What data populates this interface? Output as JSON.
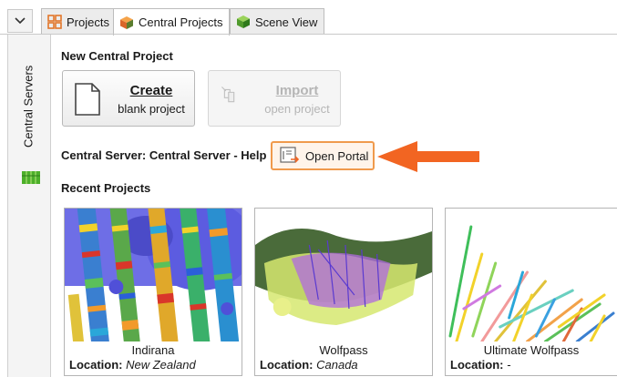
{
  "tabs": [
    {
      "label": "Projects",
      "icon": "projects-grid-icon"
    },
    {
      "label": "Central Projects",
      "icon": "central-cube-icon"
    },
    {
      "label": "Scene View",
      "icon": "scene-cube-icon"
    }
  ],
  "side_panel": {
    "label": "Central Servers",
    "icon": "server-rack-icon"
  },
  "new_project": {
    "title": "New Central Project",
    "create": {
      "label": "Create",
      "sub": "blank project",
      "icon": "blank-document-icon"
    },
    "import": {
      "label": "Import",
      "sub": "open project",
      "icon": "import-icon"
    }
  },
  "server": {
    "label": "Central Server: Central Server - Help",
    "portal_button": "Open Portal",
    "portal_icon": "open-portal-icon"
  },
  "recent": {
    "title": "Recent Projects",
    "location_label": "Location:",
    "projects": [
      {
        "name": "Indirana",
        "location": "New Zealand"
      },
      {
        "name": "Wolfpass",
        "location": "Canada"
      },
      {
        "name": "Ultimate Wolfpass",
        "location": "-"
      }
    ]
  },
  "colors": {
    "accent_orange": "#f26522",
    "portal_border": "#f09a4c"
  }
}
